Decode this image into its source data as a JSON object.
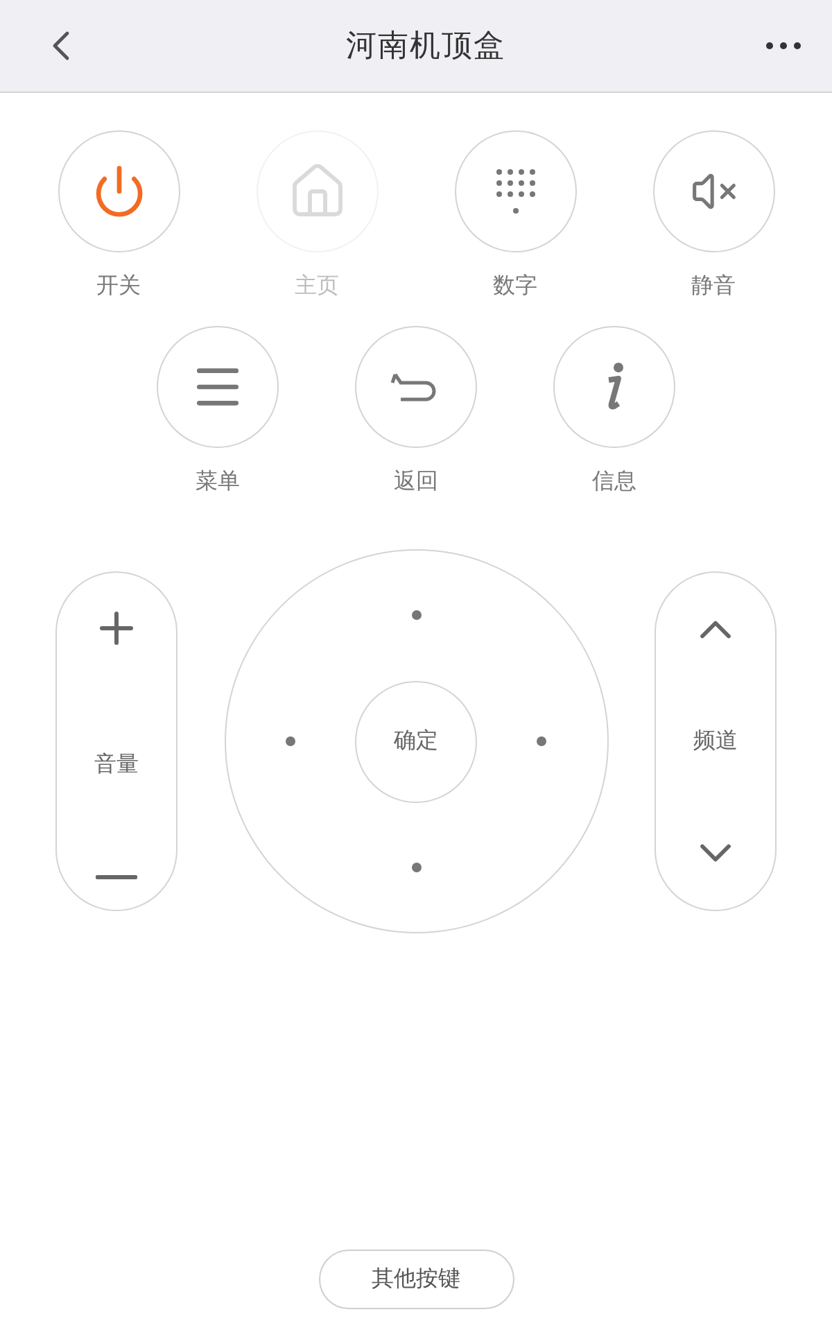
{
  "header": {
    "title": "河南机顶盒"
  },
  "top_row": [
    {
      "kind": "power",
      "label": "开关",
      "disabled": false
    },
    {
      "kind": "home",
      "label": "主页",
      "disabled": true
    },
    {
      "kind": "digits",
      "label": "数字",
      "disabled": false
    },
    {
      "kind": "mute",
      "label": "静音",
      "disabled": false
    }
  ],
  "second_row": [
    {
      "kind": "menu",
      "label": "菜单",
      "disabled": false
    },
    {
      "kind": "back",
      "label": "返回",
      "disabled": false
    },
    {
      "kind": "info",
      "label": "信息",
      "disabled": false
    }
  ],
  "volume": {
    "label": "音量"
  },
  "dpad": {
    "center_label": "确定"
  },
  "channel": {
    "label": "频道"
  },
  "more_button": {
    "label": "其他按键"
  }
}
